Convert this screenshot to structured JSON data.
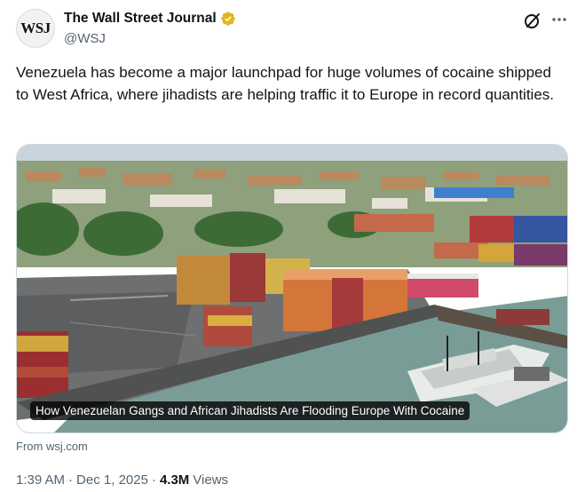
{
  "author": {
    "display_name": "The Wall Street Journal",
    "handle": "@WSJ",
    "avatar_text": "WSJ",
    "verified_color": "#e2b719"
  },
  "icons": {
    "grok": "grok-icon",
    "more": "more-icon",
    "verified": "verified-badge-icon"
  },
  "tweet": {
    "text": "Venezuela has become a major launchpad for huge volumes of cocaine shipped to West Africa, where jihadists are helping traffic it to Europe in record quantities."
  },
  "card": {
    "caption": "How Venezuelan Gangs and African Jihadists Are Flooding Europe With Cocaine",
    "source": "From wsj.com"
  },
  "meta": {
    "time": "1:39 AM",
    "date": "Dec 1, 2025",
    "views_count": "4.3M",
    "views_label": "Views",
    "separator": "·"
  }
}
